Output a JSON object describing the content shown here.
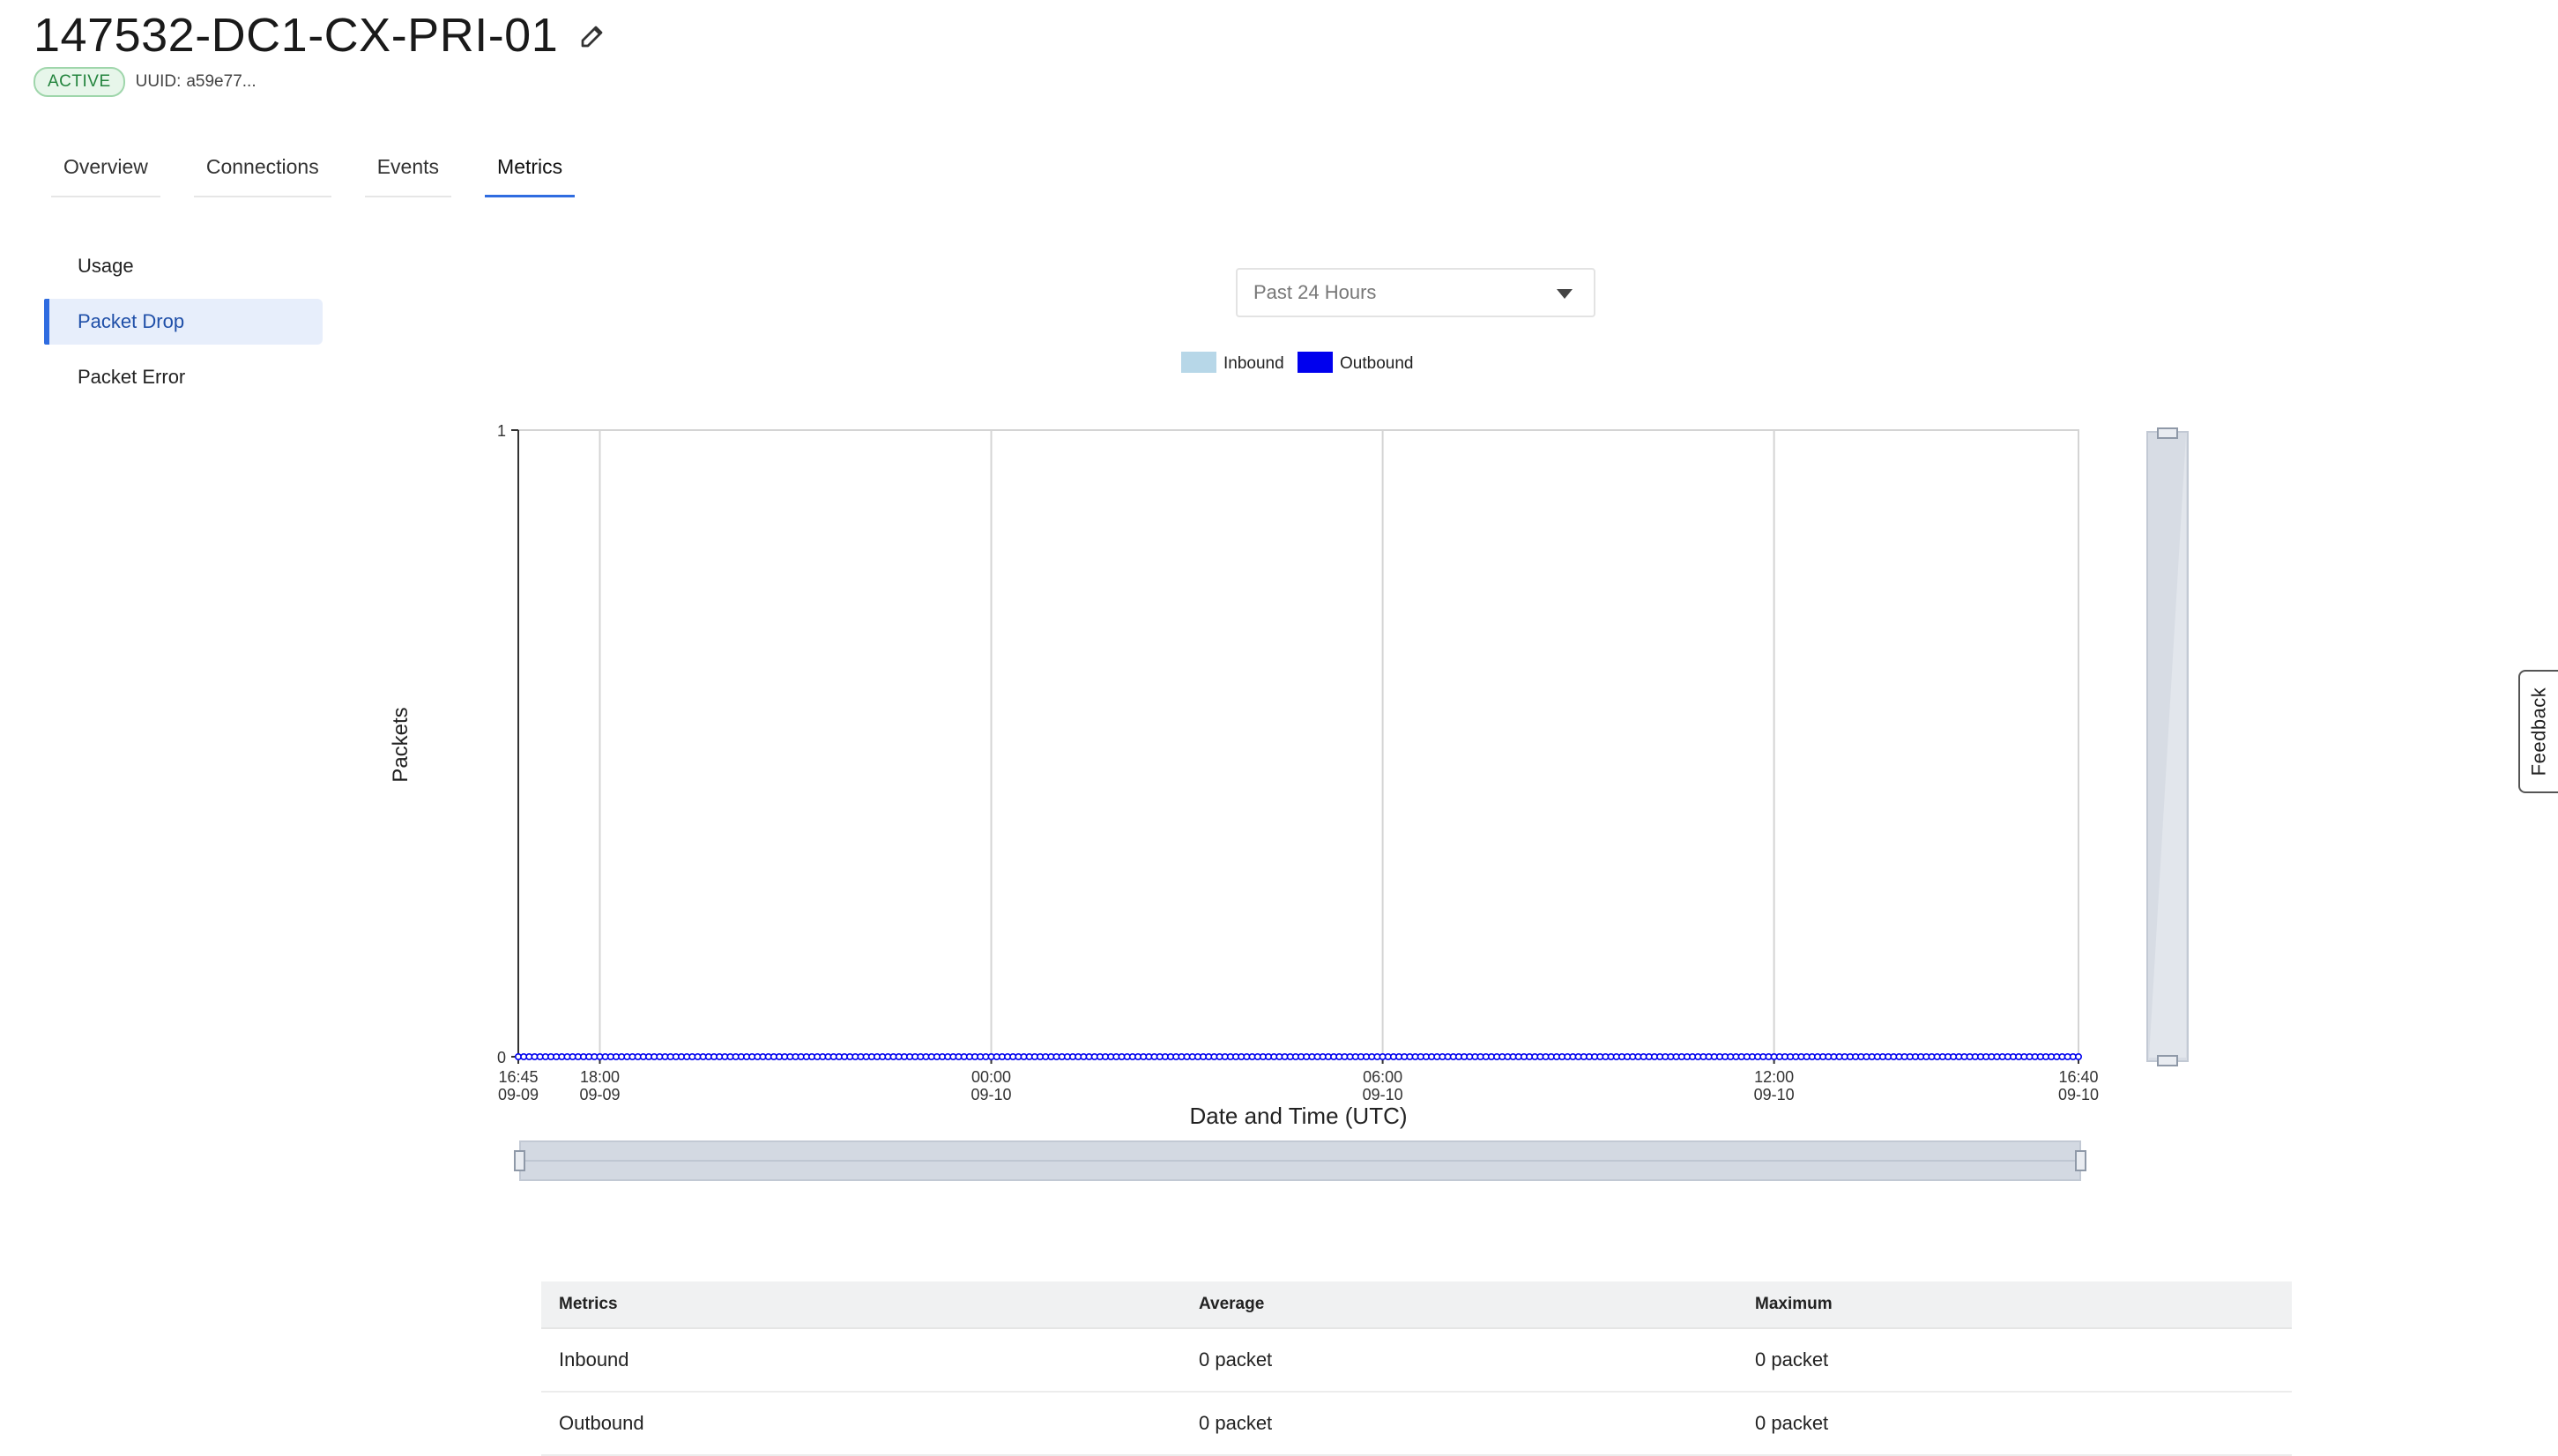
{
  "header": {
    "title": "147532-DC1-CX-PRI-01",
    "status": "ACTIVE",
    "uuid_label": "UUID:",
    "uuid_value": "a59e77..."
  },
  "tabs": [
    {
      "label": "Overview"
    },
    {
      "label": "Connections"
    },
    {
      "label": "Events"
    },
    {
      "label": "Metrics",
      "active": true
    }
  ],
  "sidebar": {
    "items": [
      {
        "label": "Usage"
      },
      {
        "label": "Packet Drop",
        "active": true
      },
      {
        "label": "Packet Error"
      }
    ]
  },
  "time_range": {
    "selected": "Past 24 Hours"
  },
  "feedback_label": "Feedback",
  "colors": {
    "inbound": "#b7d7e8",
    "outbound": "#0000ee",
    "accent": "#2f6ce0",
    "active_badge": "#23843d"
  },
  "chart_data": {
    "type": "line",
    "xlabel": "Date and Time (UTC)",
    "ylabel": "Packets",
    "ylim": [
      0,
      1
    ],
    "y_ticks": [
      "0",
      "1"
    ],
    "x_ticks": [
      {
        "time": "16:45",
        "date": "09-09"
      },
      {
        "time": "18:00",
        "date": "09-09"
      },
      {
        "time": "00:00",
        "date": "09-10"
      },
      {
        "time": "06:00",
        "date": "09-10"
      },
      {
        "time": "12:00",
        "date": "09-10"
      },
      {
        "time": "16:40",
        "date": "09-10"
      }
    ],
    "x_range": [
      "09-09 16:45",
      "09-10 16:40"
    ],
    "grid": "vertical",
    "legend": "top-center",
    "series": [
      {
        "name": "Inbound",
        "values": [
          0
        ],
        "note_constant": true
      },
      {
        "name": "Outbound",
        "values": [
          0
        ],
        "note_constant": true
      }
    ]
  },
  "table": {
    "headers": [
      "Metrics",
      "Average",
      "Maximum"
    ],
    "rows": [
      [
        "Inbound",
        "0 packet",
        "0 packet"
      ],
      [
        "Outbound",
        "0 packet",
        "0 packet"
      ]
    ]
  }
}
